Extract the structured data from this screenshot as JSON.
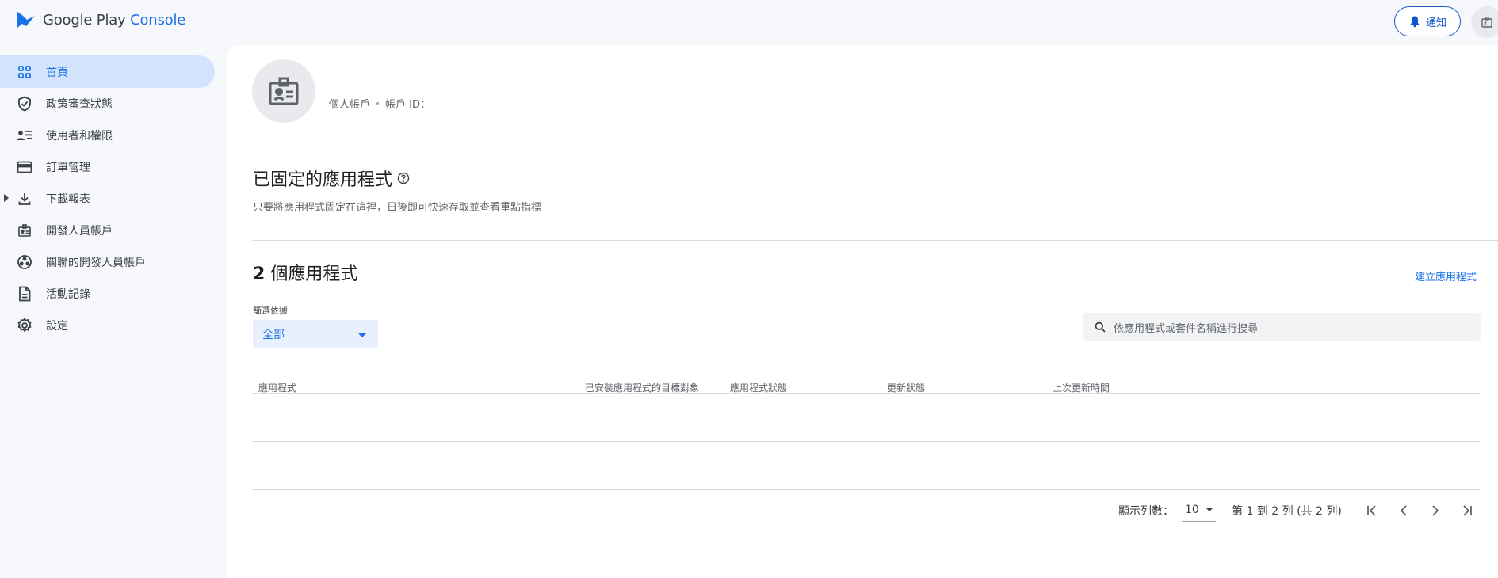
{
  "header": {
    "brand_prefix": "Google Play",
    "brand_suffix": "Console",
    "notification_label": "通知"
  },
  "sidebar": {
    "items": [
      {
        "label": "首頁",
        "icon": "grid-icon",
        "active": true
      },
      {
        "label": "政策審查狀態",
        "icon": "shield-check-icon"
      },
      {
        "label": "使用者和權限",
        "icon": "users-list-icon"
      },
      {
        "label": "訂單管理",
        "icon": "credit-card-icon"
      },
      {
        "label": "下載報表",
        "icon": "download-icon",
        "expandable": true
      },
      {
        "label": "開發人員帳戶",
        "icon": "id-badge-icon"
      },
      {
        "label": "關聯的開發人員帳戶",
        "icon": "linked-accounts-icon"
      },
      {
        "label": "活動記錄",
        "icon": "document-icon"
      },
      {
        "label": "設定",
        "icon": "gear-icon"
      }
    ]
  },
  "account": {
    "type": "個人帳戶",
    "id_label": "帳戶 ID："
  },
  "pinned": {
    "title": "已固定的應用程式",
    "description": "只要將應用程式固定在這裡，日後即可快速存取並查看重點指標"
  },
  "apps": {
    "count": "2",
    "title_suffix": "個應用程式",
    "create_label": "建立應用程式",
    "filter_label": "篩選依據",
    "filter_value": "全部",
    "search_placeholder": "依應用程式或套件名稱進行搜尋",
    "columns": [
      "應用程式",
      "已安裝應用程式的目標對象",
      "應用程式狀態",
      "更新狀態",
      "上次更新時間"
    ]
  },
  "pagination": {
    "rows_label": "顯示列數：",
    "rows_value": "10",
    "range_text": "第 1 到 2 列 (共 2 列)"
  },
  "colors": {
    "accent": "#1a73e8",
    "active_bg": "#d3e3fd",
    "canvas": "#f6f8fc"
  }
}
